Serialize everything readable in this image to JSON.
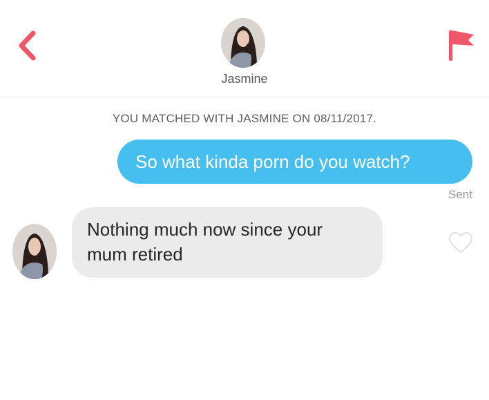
{
  "header": {
    "back_icon": "chevron-left-icon",
    "flag_icon": "flag-icon",
    "match_name": "Jasmine",
    "accent_color": "#f0566a"
  },
  "conversation": {
    "match_notice": "YOU MATCHED WITH JASMINE ON 08/11/2017.",
    "messages": [
      {
        "direction": "outgoing",
        "text": "So what kinda porn do you watch?",
        "status": "Sent",
        "bubble_color": "#46bff0"
      },
      {
        "direction": "incoming",
        "text": "Nothing much now since your mum retired",
        "bubble_color": "#ebebeb",
        "like_icon": "heart-outline-icon"
      }
    ]
  }
}
